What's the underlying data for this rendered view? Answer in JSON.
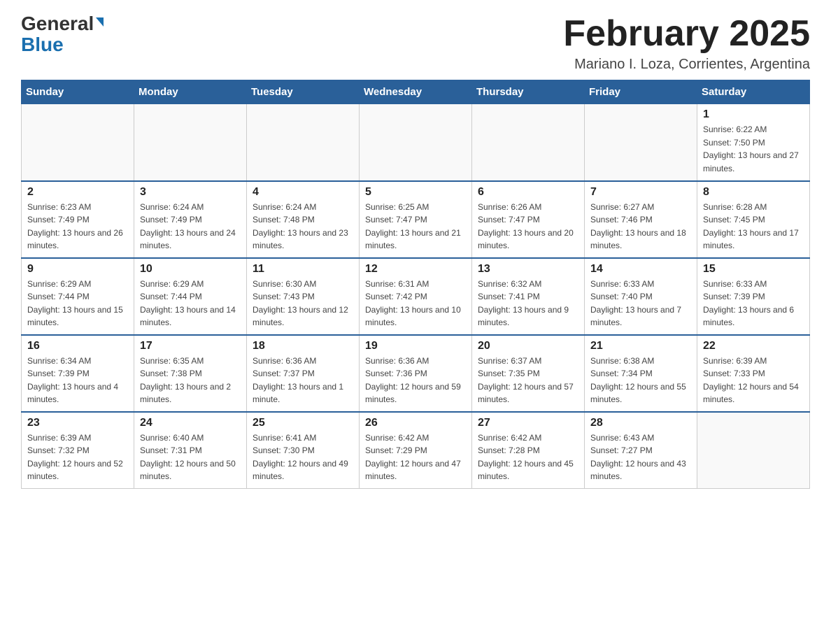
{
  "header": {
    "logo_general": "General",
    "logo_blue": "Blue",
    "month_title": "February 2025",
    "location": "Mariano I. Loza, Corrientes, Argentina"
  },
  "weekdays": [
    "Sunday",
    "Monday",
    "Tuesday",
    "Wednesday",
    "Thursday",
    "Friday",
    "Saturday"
  ],
  "weeks": [
    [
      {
        "day": "",
        "sunrise": "",
        "sunset": "",
        "daylight": ""
      },
      {
        "day": "",
        "sunrise": "",
        "sunset": "",
        "daylight": ""
      },
      {
        "day": "",
        "sunrise": "",
        "sunset": "",
        "daylight": ""
      },
      {
        "day": "",
        "sunrise": "",
        "sunset": "",
        "daylight": ""
      },
      {
        "day": "",
        "sunrise": "",
        "sunset": "",
        "daylight": ""
      },
      {
        "day": "",
        "sunrise": "",
        "sunset": "",
        "daylight": ""
      },
      {
        "day": "1",
        "sunrise": "Sunrise: 6:22 AM",
        "sunset": "Sunset: 7:50 PM",
        "daylight": "Daylight: 13 hours and 27 minutes."
      }
    ],
    [
      {
        "day": "2",
        "sunrise": "Sunrise: 6:23 AM",
        "sunset": "Sunset: 7:49 PM",
        "daylight": "Daylight: 13 hours and 26 minutes."
      },
      {
        "day": "3",
        "sunrise": "Sunrise: 6:24 AM",
        "sunset": "Sunset: 7:49 PM",
        "daylight": "Daylight: 13 hours and 24 minutes."
      },
      {
        "day": "4",
        "sunrise": "Sunrise: 6:24 AM",
        "sunset": "Sunset: 7:48 PM",
        "daylight": "Daylight: 13 hours and 23 minutes."
      },
      {
        "day": "5",
        "sunrise": "Sunrise: 6:25 AM",
        "sunset": "Sunset: 7:47 PM",
        "daylight": "Daylight: 13 hours and 21 minutes."
      },
      {
        "day": "6",
        "sunrise": "Sunrise: 6:26 AM",
        "sunset": "Sunset: 7:47 PM",
        "daylight": "Daylight: 13 hours and 20 minutes."
      },
      {
        "day": "7",
        "sunrise": "Sunrise: 6:27 AM",
        "sunset": "Sunset: 7:46 PM",
        "daylight": "Daylight: 13 hours and 18 minutes."
      },
      {
        "day": "8",
        "sunrise": "Sunrise: 6:28 AM",
        "sunset": "Sunset: 7:45 PM",
        "daylight": "Daylight: 13 hours and 17 minutes."
      }
    ],
    [
      {
        "day": "9",
        "sunrise": "Sunrise: 6:29 AM",
        "sunset": "Sunset: 7:44 PM",
        "daylight": "Daylight: 13 hours and 15 minutes."
      },
      {
        "day": "10",
        "sunrise": "Sunrise: 6:29 AM",
        "sunset": "Sunset: 7:44 PM",
        "daylight": "Daylight: 13 hours and 14 minutes."
      },
      {
        "day": "11",
        "sunrise": "Sunrise: 6:30 AM",
        "sunset": "Sunset: 7:43 PM",
        "daylight": "Daylight: 13 hours and 12 minutes."
      },
      {
        "day": "12",
        "sunrise": "Sunrise: 6:31 AM",
        "sunset": "Sunset: 7:42 PM",
        "daylight": "Daylight: 13 hours and 10 minutes."
      },
      {
        "day": "13",
        "sunrise": "Sunrise: 6:32 AM",
        "sunset": "Sunset: 7:41 PM",
        "daylight": "Daylight: 13 hours and 9 minutes."
      },
      {
        "day": "14",
        "sunrise": "Sunrise: 6:33 AM",
        "sunset": "Sunset: 7:40 PM",
        "daylight": "Daylight: 13 hours and 7 minutes."
      },
      {
        "day": "15",
        "sunrise": "Sunrise: 6:33 AM",
        "sunset": "Sunset: 7:39 PM",
        "daylight": "Daylight: 13 hours and 6 minutes."
      }
    ],
    [
      {
        "day": "16",
        "sunrise": "Sunrise: 6:34 AM",
        "sunset": "Sunset: 7:39 PM",
        "daylight": "Daylight: 13 hours and 4 minutes."
      },
      {
        "day": "17",
        "sunrise": "Sunrise: 6:35 AM",
        "sunset": "Sunset: 7:38 PM",
        "daylight": "Daylight: 13 hours and 2 minutes."
      },
      {
        "day": "18",
        "sunrise": "Sunrise: 6:36 AM",
        "sunset": "Sunset: 7:37 PM",
        "daylight": "Daylight: 13 hours and 1 minute."
      },
      {
        "day": "19",
        "sunrise": "Sunrise: 6:36 AM",
        "sunset": "Sunset: 7:36 PM",
        "daylight": "Daylight: 12 hours and 59 minutes."
      },
      {
        "day": "20",
        "sunrise": "Sunrise: 6:37 AM",
        "sunset": "Sunset: 7:35 PM",
        "daylight": "Daylight: 12 hours and 57 minutes."
      },
      {
        "day": "21",
        "sunrise": "Sunrise: 6:38 AM",
        "sunset": "Sunset: 7:34 PM",
        "daylight": "Daylight: 12 hours and 55 minutes."
      },
      {
        "day": "22",
        "sunrise": "Sunrise: 6:39 AM",
        "sunset": "Sunset: 7:33 PM",
        "daylight": "Daylight: 12 hours and 54 minutes."
      }
    ],
    [
      {
        "day": "23",
        "sunrise": "Sunrise: 6:39 AM",
        "sunset": "Sunset: 7:32 PM",
        "daylight": "Daylight: 12 hours and 52 minutes."
      },
      {
        "day": "24",
        "sunrise": "Sunrise: 6:40 AM",
        "sunset": "Sunset: 7:31 PM",
        "daylight": "Daylight: 12 hours and 50 minutes."
      },
      {
        "day": "25",
        "sunrise": "Sunrise: 6:41 AM",
        "sunset": "Sunset: 7:30 PM",
        "daylight": "Daylight: 12 hours and 49 minutes."
      },
      {
        "day": "26",
        "sunrise": "Sunrise: 6:42 AM",
        "sunset": "Sunset: 7:29 PM",
        "daylight": "Daylight: 12 hours and 47 minutes."
      },
      {
        "day": "27",
        "sunrise": "Sunrise: 6:42 AM",
        "sunset": "Sunset: 7:28 PM",
        "daylight": "Daylight: 12 hours and 45 minutes."
      },
      {
        "day": "28",
        "sunrise": "Sunrise: 6:43 AM",
        "sunset": "Sunset: 7:27 PM",
        "daylight": "Daylight: 12 hours and 43 minutes."
      },
      {
        "day": "",
        "sunrise": "",
        "sunset": "",
        "daylight": ""
      }
    ]
  ]
}
